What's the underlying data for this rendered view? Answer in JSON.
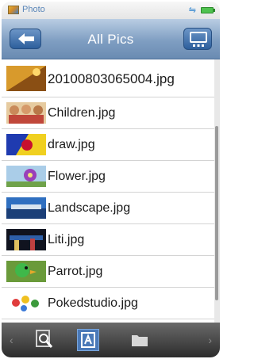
{
  "status_bar": {
    "app_name": "Photo",
    "icons": [
      "photo-app-icon",
      "usb-icon",
      "battery-icon"
    ]
  },
  "header": {
    "title": "All Pics",
    "back_icon": "back-arrow-icon",
    "menu_icon": "menu-icon"
  },
  "files": [
    {
      "name": "20100803065004.jpg",
      "thumb": "sunset"
    },
    {
      "name": "Children.jpg",
      "thumb": "children"
    },
    {
      "name": "draw.jpg",
      "thumb": "draw"
    },
    {
      "name": "Flower.jpg",
      "thumb": "flower"
    },
    {
      "name": "Landscape.jpg",
      "thumb": "landscape"
    },
    {
      "name": "Liti.jpg",
      "thumb": "liti"
    },
    {
      "name": "Parrot.jpg",
      "thumb": "parrot"
    },
    {
      "name": "Pokedstudio.jpg",
      "thumb": "pokedstudio"
    }
  ],
  "toolbar": {
    "items": [
      "search-icon",
      "view-icon",
      "folder-icon"
    ],
    "selected": "view-icon",
    "left_arrow": "‹",
    "right_arrow": "›"
  },
  "colors": {
    "header_blue": "#7f9ec2",
    "button_blue": "#2d5f9c",
    "toolbar_dark": "#2c2c2c"
  }
}
